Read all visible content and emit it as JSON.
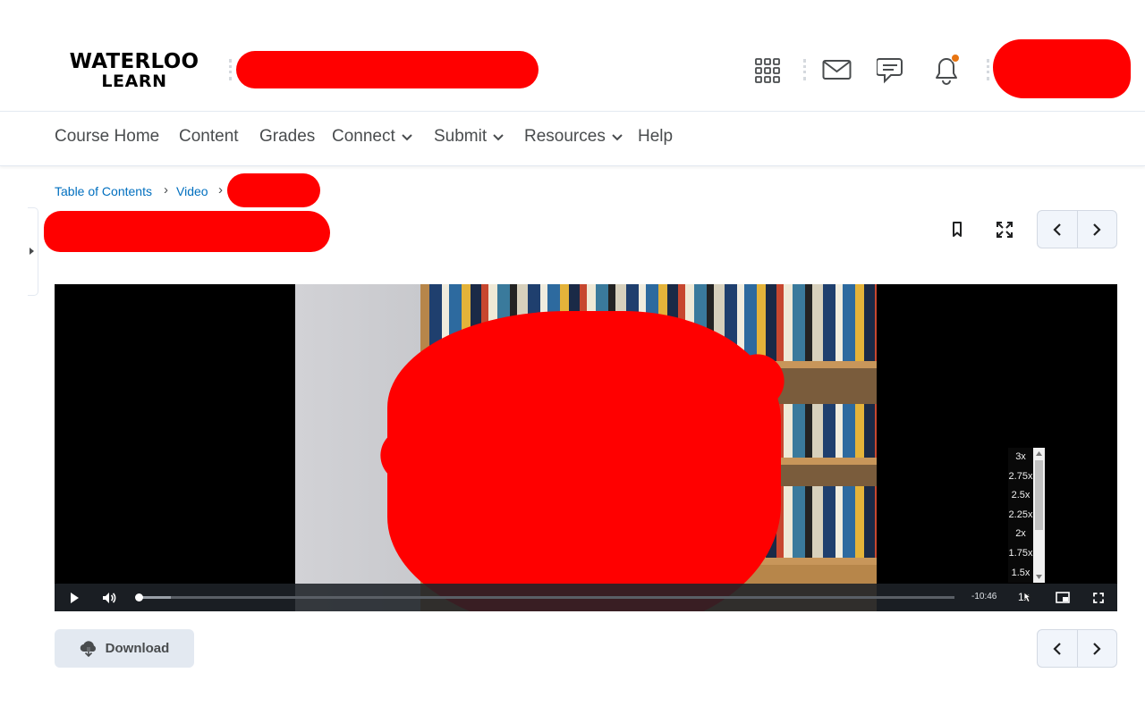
{
  "brand": {
    "line1": "WATERLOO",
    "line2": "LEARN"
  },
  "header": {
    "icons": [
      "apps-grid-icon",
      "mail-icon",
      "chat-icon",
      "bell-icon"
    ],
    "notification_color": "#e87511"
  },
  "nav": {
    "items": [
      {
        "label": "Course Home",
        "dropdown": false
      },
      {
        "label": "Content",
        "dropdown": false
      },
      {
        "label": "Grades",
        "dropdown": false
      },
      {
        "label": "Connect",
        "dropdown": true
      },
      {
        "label": "Submit",
        "dropdown": true
      },
      {
        "label": "Resources",
        "dropdown": true
      },
      {
        "label": "Help",
        "dropdown": false
      }
    ]
  },
  "breadcrumb": {
    "items": [
      "Table of Contents",
      "Video"
    ],
    "separator": "›"
  },
  "toolbar": {
    "icons": [
      "bookmark-icon",
      "fullscreen-expand-icon"
    ]
  },
  "player": {
    "time_remaining": "-10:46",
    "rate_label": "1x",
    "progress_fraction": 0.0,
    "buffered_fraction": 0.04,
    "speed_options": [
      "3x",
      "2.75x",
      "2.5x",
      "2.25x",
      "2x",
      "1.75x",
      "1.5x"
    ]
  },
  "actions": {
    "download_label": "Download"
  },
  "colors": {
    "link": "#006fbf",
    "redaction": "#ff0000",
    "button_bg": "#e3e9f1"
  }
}
